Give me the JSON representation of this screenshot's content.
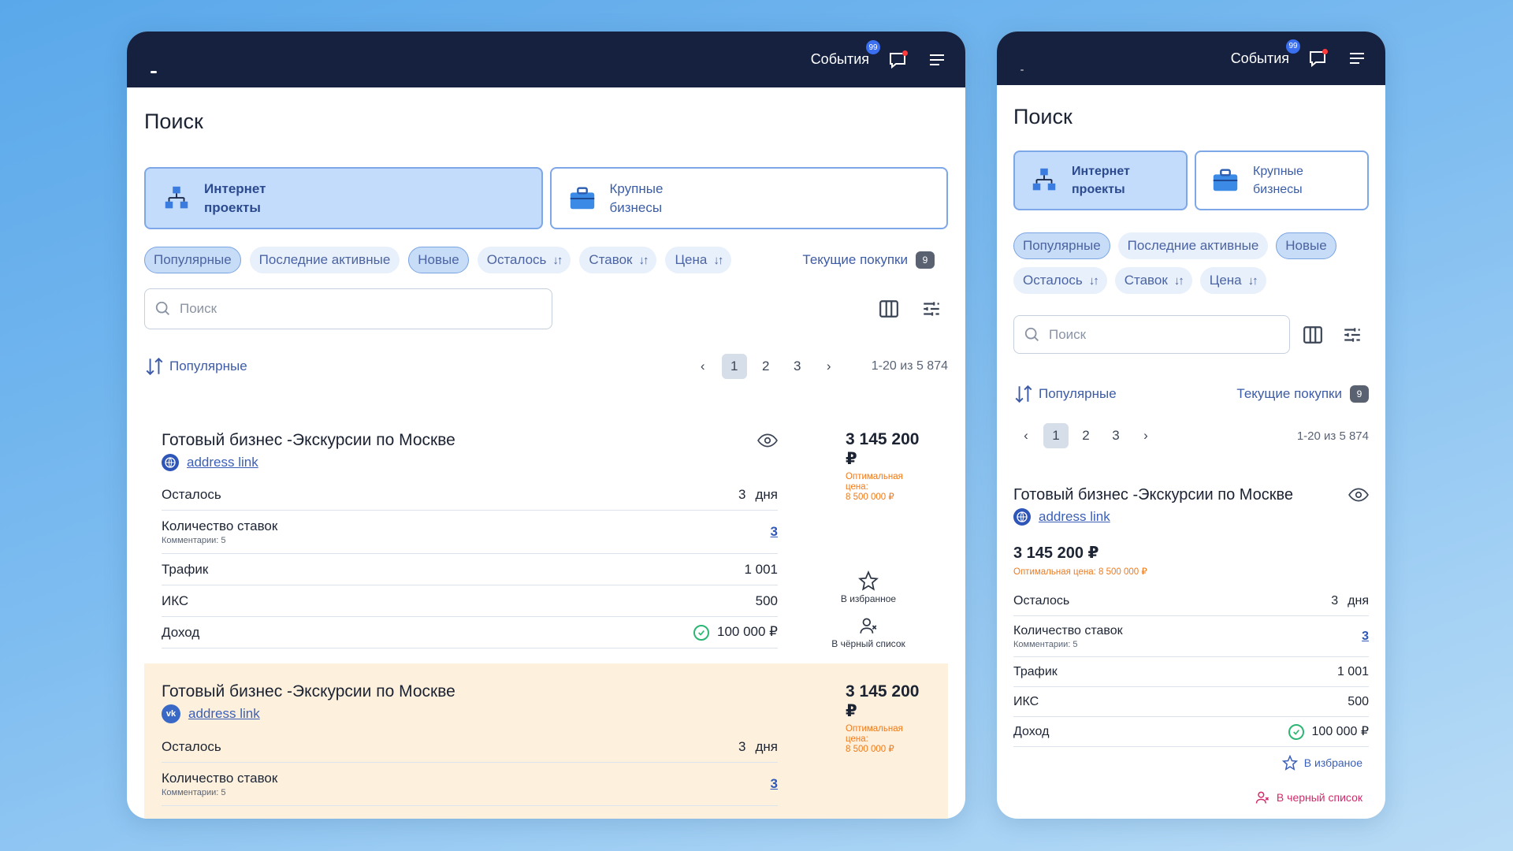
{
  "header": {
    "events_label": "События",
    "events_badge": "99"
  },
  "page_title": "Поиск",
  "categories": [
    {
      "line1": "Интернет",
      "line2": "проекты"
    },
    {
      "line1": "Крупные",
      "line2": "бизнесы"
    }
  ],
  "chips": [
    "Популярные",
    "Последние активные",
    "Новые",
    "Осталось",
    "Ставок",
    "Цена"
  ],
  "purchases": {
    "label": "Текущие покупки",
    "count": "9"
  },
  "search": {
    "placeholder": "Поиск"
  },
  "sort_label": "Популярные",
  "pager": {
    "pages": [
      "1",
      "2",
      "3"
    ],
    "info": "1-20 из 5 874"
  },
  "listing": {
    "title": "Готовый бизнес -Экскурсии по Москве",
    "link": "address link",
    "price": "3 145 200 ₽",
    "opt_label": "Оптимальная цена:",
    "opt_value": "8 500 000 ₽",
    "rows": {
      "left_label": "Осталось",
      "left_value": "3",
      "left_unit": "дня",
      "bids_label": "Количество ставок",
      "bids_sub": "Комментарии: 5",
      "bids_value": "3",
      "traffic_label": "Трафик",
      "traffic_value": "1 001",
      "iks_label": "ИКС",
      "iks_value": "500",
      "income_label": "Доход",
      "income_value": "100 000 ₽"
    },
    "fav_label": "В избранное",
    "blacklist_label": "В чёрный список"
  },
  "mobile": {
    "opt_full": "Оптимальная цена: 8 500 000 ₽",
    "fav_label": "В избраное",
    "blacklist_label": "В черный список"
  },
  "colors": {
    "topbar": "#15213f",
    "accent": "#3b5fb8",
    "highlight": "#fdf1de",
    "warning": "#f07a1a"
  }
}
